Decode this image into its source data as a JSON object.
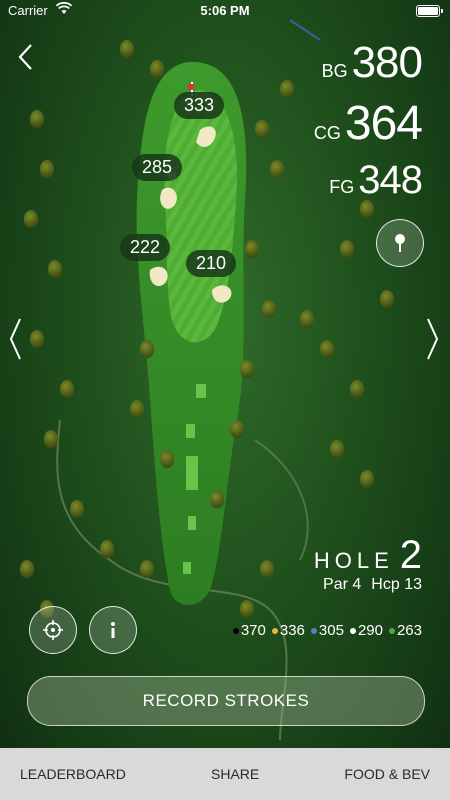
{
  "status_bar": {
    "carrier": "Carrier",
    "time": "5:06 PM"
  },
  "yardages": [
    {
      "label": "BG",
      "value": "380"
    },
    {
      "label": "CG",
      "value": "364"
    },
    {
      "label": "FG",
      "value": "348"
    }
  ],
  "map_markers": [
    {
      "value": "333"
    },
    {
      "value": "285"
    },
    {
      "value": "222"
    },
    {
      "value": "210"
    }
  ],
  "hole": {
    "title": "HOLE",
    "number": "2",
    "par": "Par 4",
    "hcp": "Hcp 13"
  },
  "tees": [
    {
      "color": "#000000",
      "yards": "370"
    },
    {
      "color": "#e8b93a",
      "yards": "336"
    },
    {
      "color": "#5b7fb8",
      "yards": "305"
    },
    {
      "color": "#ffffff",
      "yards": "290"
    },
    {
      "color": "#4ea84a",
      "yards": "263"
    }
  ],
  "buttons": {
    "record": "RECORD STROKES"
  },
  "icons": {
    "back": "chevron-left-icon",
    "prev": "chevron-left-icon",
    "next": "chevron-right-icon",
    "pin": "pin-marker-icon",
    "locate": "crosshair-icon",
    "info": "info-icon"
  },
  "bottom_nav": [
    {
      "label": "LEADERBOARD"
    },
    {
      "label": "SHARE"
    },
    {
      "label": "FOOD & BEV"
    }
  ]
}
